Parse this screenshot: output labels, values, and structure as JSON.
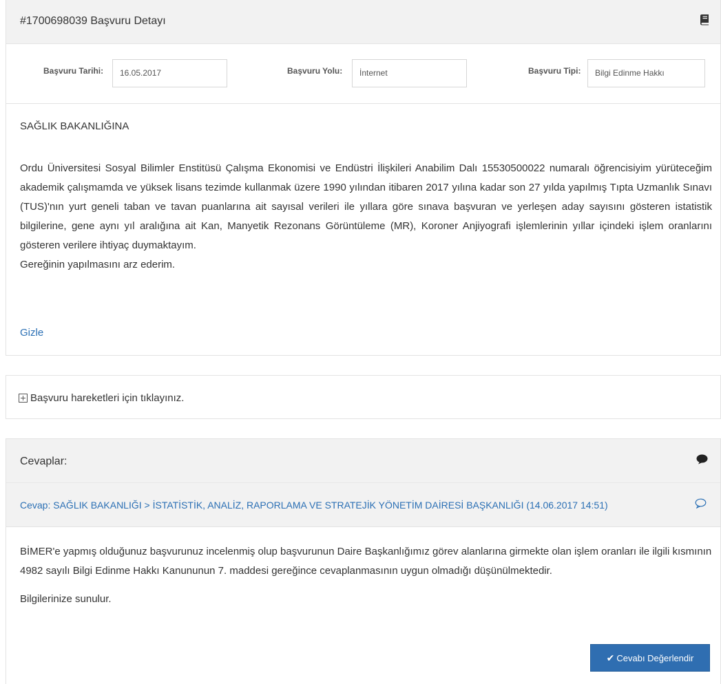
{
  "detail": {
    "title": "#1700698039 Başvuru Detayı",
    "icon": "book-icon",
    "fields": [
      {
        "label": "Başvuru Tarihi:",
        "value": "16.05.2017"
      },
      {
        "label": "Başvuru Yolu:",
        "value": "İnternet"
      },
      {
        "label": "Başvuru Tipi:",
        "value": "Bilgi Edinme Hakkı"
      }
    ],
    "addressee": "SAĞLIK BAKANLIĞINA",
    "body_paragraph": "Ordu Üniversitesi Sosyal Bilimler Enstitüsü Çalışma Ekonomisi ve Endüstri İlişkileri Anabilim Dalı 15530500022 numaralı öğrencisiyim yürüteceğim akademik çalışmamda ve yüksek lisans tezimde kullanmak üzere 1990 yılından itibaren 2017 yılına kadar son 27 yılda yapılmış Tıpta Uzmanlık Sınavı (TUS)'nın yurt geneli taban ve tavan puanlarına ait sayısal verileri ile yıllara göre sınava başvuran ve yerleşen aday sayısını gösteren istatistik bilgilerine, gene aynı yıl aralığına ait Kan, Manyetik Rezonans Görüntüleme (MR), Koroner Anjiyografi işlemlerinin yıllar içindeki işlem oranlarını gösteren verilere ihtiyaç duymaktayım.",
    "closing": "Gereğinin yapılmasını arz ederim.",
    "hide_link": "Gizle"
  },
  "movements": {
    "label": "Başvuru hareketleri için tıklayınız."
  },
  "answers": {
    "title": "Cevaplar:",
    "response_link": "Cevap: SAĞLIK BAKANLIĞI > İSTATİSTİK, ANALİZ, RAPORLAMA VE STRATEJİK YÖNETİM DAİRESİ BAŞKANLIĞI (14.06.2017 14:51)",
    "response_text": "BİMER'e yapmış olduğunuz başvurunuz incelenmiş olup başvurunun Daire Başkanlığımız görev alanlarına girmekte olan işlem oranları ile ilgili kısmının 4982 sayılı Bilgi Edinme Hakkı Kanununun 7. maddesi gereğince cevaplanmasının uygun olmadığı düşünülmektedir.",
    "response_closing": "Bilgilerinize sunulur.",
    "evaluate_button": "Cevabı Değerlendir"
  }
}
